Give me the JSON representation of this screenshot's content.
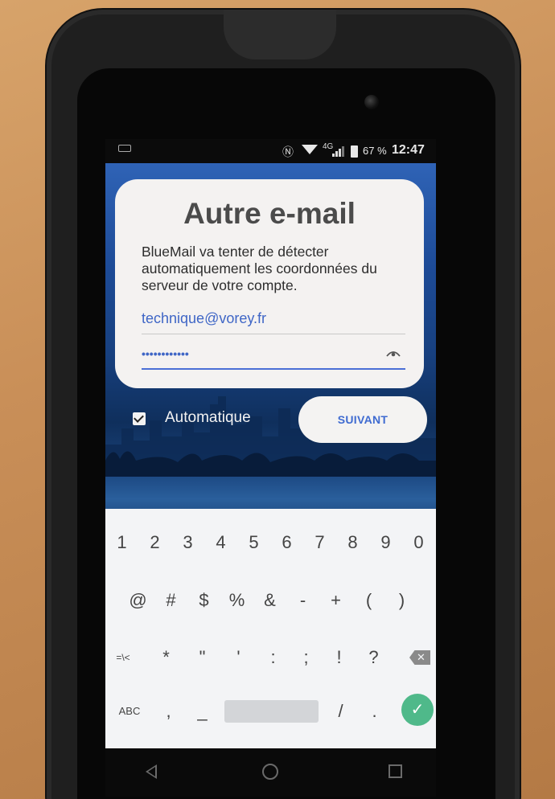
{
  "status_bar": {
    "network": "4G",
    "battery": "67 %",
    "time": "12:47"
  },
  "card": {
    "title": "Autre e-mail",
    "description": "BlueMail va tenter de détecter automatiquement les coordonnées du serveur de votre compte.",
    "email_value": "technique@vorey.fr",
    "password_mask": "••••••••••••"
  },
  "options": {
    "automatic_label": "Automatique",
    "automatic_checked": true,
    "next_label": "SUIVANT"
  },
  "keyboard": {
    "row1": [
      "1",
      "2",
      "3",
      "4",
      "5",
      "6",
      "7",
      "8",
      "9",
      "0"
    ],
    "row2": [
      "@",
      "#",
      "$",
      "%",
      "&",
      "-",
      "+",
      "(",
      ")"
    ],
    "row3": [
      "=\\<",
      "*",
      "\"",
      "'",
      ":",
      ";",
      "!",
      "?"
    ],
    "row4": {
      "abc": "ABC",
      "keys": [
        ",",
        "_",
        "/",
        "."
      ]
    }
  },
  "icons": {
    "checkbox": "check-icon",
    "eye": "eye-icon",
    "backspace": "backspace-icon",
    "enter": "check-icon",
    "nav": [
      "back-icon",
      "home-icon",
      "recents-icon"
    ]
  },
  "colors": {
    "accent": "#3f66c6",
    "enter_key": "#4fb98a",
    "card_bg": "#f4f2f1"
  }
}
